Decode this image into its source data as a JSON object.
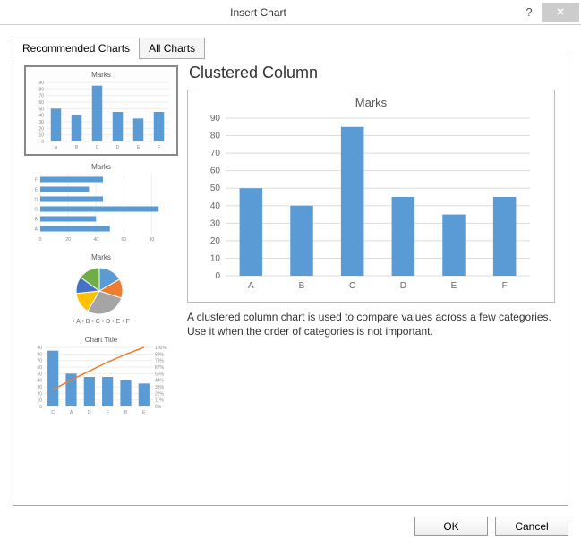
{
  "titlebar": {
    "title": "Insert Chart",
    "help": "?",
    "close": "✕"
  },
  "tabs": {
    "recommended": "Recommended Charts",
    "all": "All Charts"
  },
  "thumbs": {
    "t1_title": "Marks",
    "t2_title": "Marks",
    "t3_title": "Marks",
    "t3_legend": "• A  • B  • C  • D  • E  • F",
    "t4_title": "Chart Title"
  },
  "preview": {
    "heading": "Clustered Column",
    "chart_title": "Marks",
    "description": "A clustered column chart is used to compare values across a few categories. Use it when the order of categories is not important."
  },
  "footer": {
    "ok": "OK",
    "cancel": "Cancel"
  },
  "chart_data": {
    "type": "bar",
    "title": "Marks",
    "categories": [
      "A",
      "B",
      "C",
      "D",
      "E",
      "F"
    ],
    "values": [
      50,
      40,
      85,
      45,
      35,
      45
    ],
    "ylabel": "",
    "xlabel": "",
    "ylim": [
      0,
      90
    ],
    "ytick": 10,
    "color": "#5b9bd5"
  }
}
